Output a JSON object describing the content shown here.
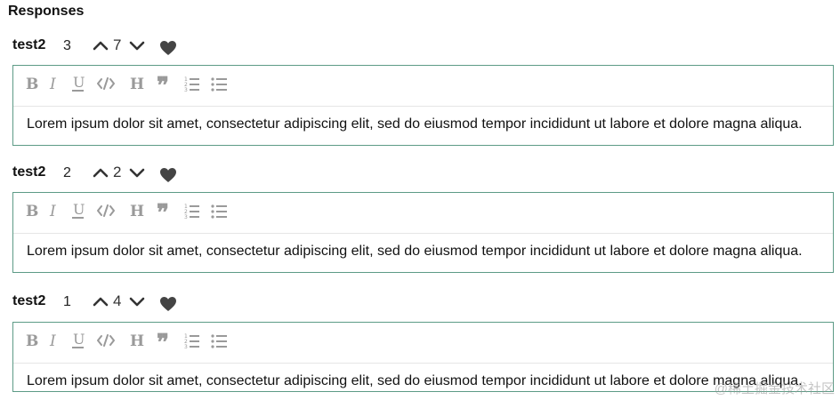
{
  "page": {
    "title": "Responses"
  },
  "responses": [
    {
      "author": "test2",
      "rank": "3",
      "votes": "7",
      "content": "Lorem ipsum dolor sit amet, consectetur adipiscing elit, sed do eiusmod tempor incididunt ut labore et dolore magna aliqua."
    },
    {
      "author": "test2",
      "rank": "2",
      "votes": "2",
      "content": "Lorem ipsum dolor sit amet, consectetur adipiscing elit, sed do eiusmod tempor incididunt ut labore et dolore magna aliqua."
    },
    {
      "author": "test2",
      "rank": "1",
      "votes": "4",
      "content": "Lorem ipsum dolor sit amet, consectetur adipiscing elit, sed do eiusmod tempor incididunt ut labore et dolore magna aliqua."
    }
  ],
  "toolbar_icons": [
    "bold-icon",
    "italic-icon",
    "underline-icon",
    "code-icon",
    "heading-icon",
    "quote-icon",
    "ordered-list-icon",
    "bullet-list-icon"
  ],
  "watermark": "@稀土掘金技术社区",
  "colors": {
    "editor_border": "#5d9b86",
    "toolbar_icon": "#9a9a9a",
    "heart": "#444444"
  }
}
